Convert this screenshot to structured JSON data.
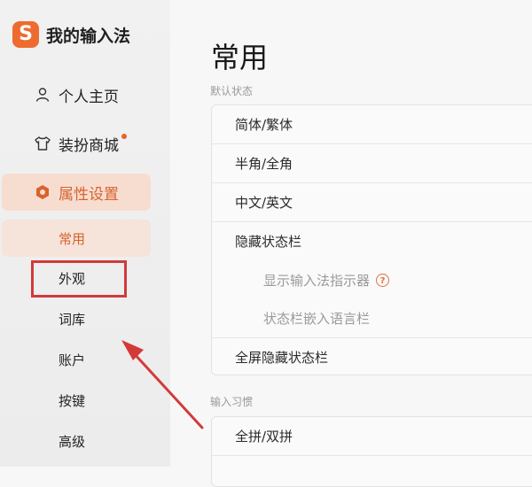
{
  "brand": {
    "logo_letter": "S",
    "name": "我的输入法"
  },
  "sidebar": {
    "nav": [
      {
        "label": "个人主页",
        "icon": "user-icon"
      },
      {
        "label": "装扮商城",
        "icon": "shirt-icon",
        "badge": true
      },
      {
        "label": "属性设置",
        "icon": "hexagon-settings-icon",
        "active": true
      }
    ],
    "sub": [
      {
        "label": "常用",
        "active": true
      },
      {
        "label": "外观"
      },
      {
        "label": "词库"
      },
      {
        "label": "账户"
      },
      {
        "label": "按键"
      },
      {
        "label": "高级"
      }
    ]
  },
  "main": {
    "title": "常用",
    "status_section": {
      "label": "默认状态",
      "rows": [
        "简体/繁体",
        "半角/全角",
        "中文/英文",
        "隐藏状态栏",
        "显示输入法指示器",
        "状态栏嵌入语言栏",
        "全屏隐藏状态栏"
      ]
    },
    "habits_section": {
      "label": "输入习惯",
      "rows": [
        "全拼/双拼"
      ]
    }
  },
  "colors": {
    "accent": "#d9622e",
    "annotation": "#d23a3a"
  }
}
